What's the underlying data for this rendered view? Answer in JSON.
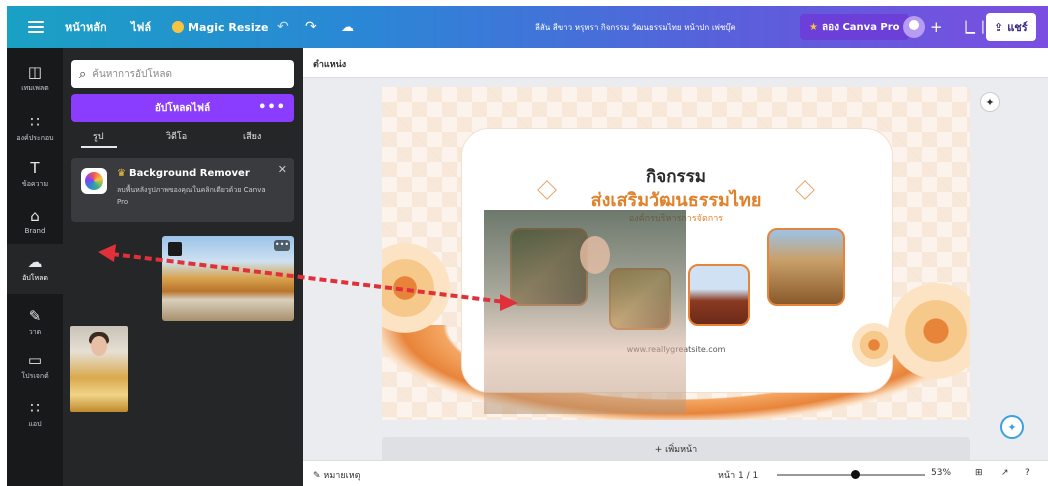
{
  "topbar": {
    "home": "หน้าหลัก",
    "file": "ไฟล์",
    "magic_resize": "Magic Resize",
    "doc_title": "ลีลัน สีขาว หรุหรา กิจกรรม วัฒนธรรมไทย หน้าปก เพ่ชบุ๊ค",
    "try_pro": "ลอง Canva Pro",
    "share": "แชร์"
  },
  "sidebar": {
    "items": [
      {
        "icon": "templates-icon",
        "label": "เทมเพลต"
      },
      {
        "icon": "elements-icon",
        "label": "องค์ประกอบ"
      },
      {
        "icon": "text-icon",
        "label": "ข้อความ"
      },
      {
        "icon": "brand-icon",
        "label": "Brand"
      },
      {
        "icon": "uploads-icon",
        "label": "อัปโหลด"
      },
      {
        "icon": "draw-icon",
        "label": "วาด"
      },
      {
        "icon": "projects-icon",
        "label": "โปรเจกต์"
      },
      {
        "icon": "apps-icon",
        "label": "แอป"
      }
    ]
  },
  "panel": {
    "search_placeholder": "ค้นหาการอัปโหลด",
    "upload_button": "อัปโหลดไฟล์",
    "upload_more": "•••",
    "tabs": [
      "รูป",
      "วิดีโอ",
      "เสียง"
    ],
    "bg_remover": {
      "title": "Background Remover",
      "desc": "ลบพื้นหลังรูปภาพของคุณในคลิกเดียวด้วย Canva Pro"
    },
    "thumb_more": "•••"
  },
  "editor": {
    "position_label": "ตำแหน่ง",
    "design": {
      "title1": "กิจกรรม",
      "title2": "ส่งเสริมวัฒนธรรมไทย",
      "subtitle": "องค์กรบริหารการจัดการ",
      "url": "www.reallygreatsite.com"
    },
    "add_page": "+ เพิ่มหน้า"
  },
  "bottombar": {
    "notes": "หมายเหตุ",
    "page_indicator": "หน้า 1 / 1",
    "zoom": "53%",
    "zoom_fraction": 0.53
  },
  "colors": {
    "canva_purple": "#8b3dff",
    "accent_orange": "#e0812b",
    "arrow_red": "#e0303a"
  }
}
